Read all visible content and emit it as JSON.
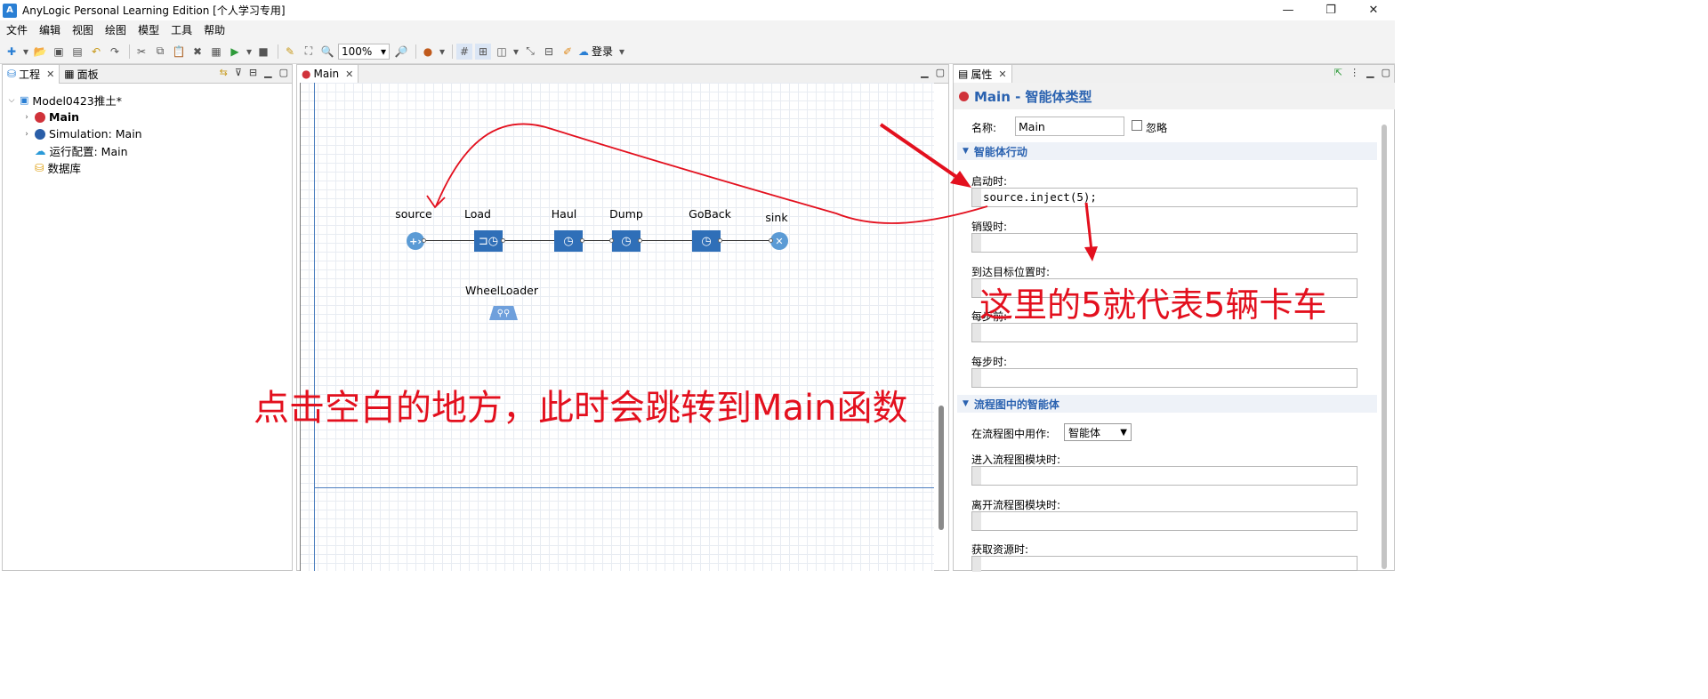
{
  "window": {
    "title": "AnyLogic Personal Learning Edition [个人学习专用]",
    "logo_text": "A",
    "minimize": "—",
    "restore": "❐",
    "close": "✕"
  },
  "menu": [
    "文件",
    "编辑",
    "视图",
    "绘图",
    "模型",
    "工具",
    "帮助"
  ],
  "toolbar": {
    "zoom": "100%",
    "login": "登录"
  },
  "project_panel": {
    "tabs": [
      {
        "label": "工程"
      },
      {
        "label": "面板"
      }
    ],
    "tree": [
      {
        "label": "Model0423推土*",
        "icon": "model-icon"
      },
      {
        "label": "Main",
        "icon": "agent-icon",
        "bold": true
      },
      {
        "label": "Simulation: Main",
        "icon": "simulation-icon"
      },
      {
        "label": "运行配置: Main",
        "icon": "cloud-icon"
      },
      {
        "label": "数据库",
        "icon": "database-icon"
      }
    ]
  },
  "editor": {
    "tab": "Main",
    "blocks": [
      {
        "name": "source",
        "icon": "source-icon"
      },
      {
        "name": "Load",
        "icon": "seize-delay-icon"
      },
      {
        "name": "Haul",
        "icon": "delay-icon"
      },
      {
        "name": "Dump",
        "icon": "delay-icon"
      },
      {
        "name": "GoBack",
        "icon": "delay-icon"
      },
      {
        "name": "sink",
        "icon": "sink-icon"
      }
    ],
    "resource": {
      "name": "WheelLoader",
      "icon": "resource-pool-icon"
    }
  },
  "properties": {
    "tab": "属性",
    "header": "Main - 智能体类型",
    "name_label": "名称:",
    "name_value": "Main",
    "ignore_label": "忽略",
    "section_actions": "智能体行动",
    "on_startup_label": "启动时:",
    "on_startup_code": "source.inject(5);",
    "on_destroy_label": "销毁时:",
    "on_arrival_label": "到达目标位置时:",
    "before_step_label": "每步前:",
    "on_step_label": "每步时:",
    "section_flowchart": "流程图中的智能体",
    "use_in_flowchart_label": "在流程图中用作:",
    "use_in_flowchart_value": "智能体",
    "on_enter_block_label": "进入流程图模块时:",
    "on_exit_block_label": "离开流程图模块时:",
    "on_seize_label": "获取资源时:"
  },
  "annotations": {
    "trucks": "这里的5就代表5辆卡车",
    "click_blank": "点击空白的地方，此时会跳转到Main函数"
  },
  "colors": {
    "annotation": "#e3101e",
    "accent": "#2a62b0",
    "block": "#2f6fb8"
  }
}
